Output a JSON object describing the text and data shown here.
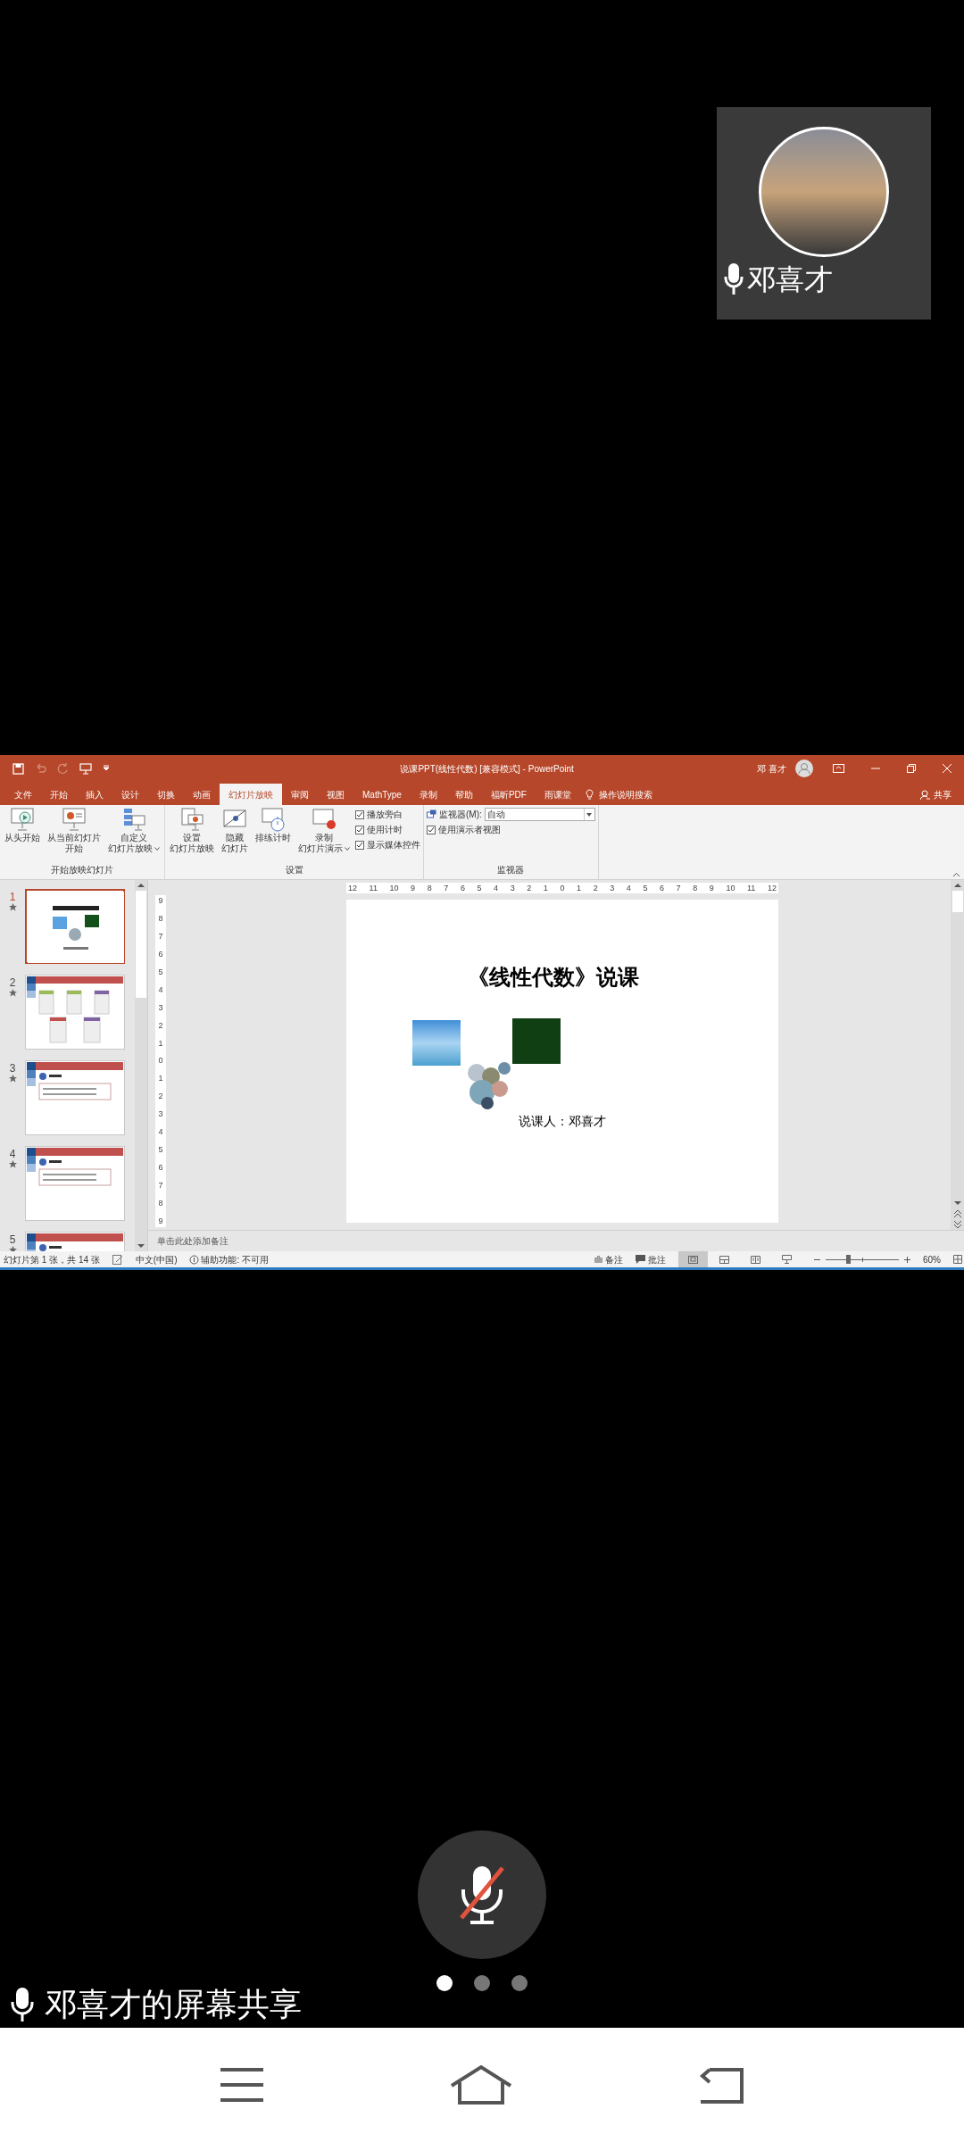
{
  "video_tile": {
    "name": "邓喜才"
  },
  "powerpoint": {
    "title": "说课PPT(线性代数) [兼容模式] - PowerPoint",
    "user": "邓 喜才",
    "tabs": [
      {
        "label": "文件",
        "selected": false
      },
      {
        "label": "开始",
        "selected": false
      },
      {
        "label": "插入",
        "selected": false
      },
      {
        "label": "设计",
        "selected": false
      },
      {
        "label": "切换",
        "selected": false
      },
      {
        "label": "动画",
        "selected": false
      },
      {
        "label": "幻灯片放映",
        "selected": true
      },
      {
        "label": "审阅",
        "selected": false
      },
      {
        "label": "视图",
        "selected": false
      },
      {
        "label": "MathType",
        "selected": false
      },
      {
        "label": "录制",
        "selected": false
      },
      {
        "label": "帮助",
        "selected": false
      },
      {
        "label": "福昕PDF",
        "selected": false
      },
      {
        "label": "雨课堂",
        "selected": false
      }
    ],
    "tell_me": "操作说明搜索",
    "share": "共享",
    "ribbon_groups": [
      {
        "label": "开始放映幻灯片",
        "items": [
          {
            "kind": "large",
            "lines": [
              "从头开始"
            ]
          },
          {
            "kind": "large",
            "lines": [
              "从当前幻灯片",
              "开始"
            ]
          },
          {
            "kind": "dropdown",
            "lines": [
              "自定义",
              "幻灯片放映"
            ]
          }
        ]
      },
      {
        "label": "设置",
        "items": [
          {
            "kind": "large",
            "lines": [
              "设置",
              "幻灯片放映"
            ]
          },
          {
            "kind": "large",
            "lines": [
              "隐藏",
              "幻灯片"
            ]
          },
          {
            "kind": "large",
            "lines": [
              "排练计时"
            ]
          },
          {
            "kind": "dropdown",
            "lines": [
              "录制",
              "幻灯片演示"
            ]
          },
          {
            "kind": "checks",
            "checks": [
              {
                "label": "播放旁白",
                "checked": true
              },
              {
                "label": "使用计时",
                "checked": true
              },
              {
                "label": "显示媒体控件",
                "checked": true
              }
            ]
          }
        ]
      },
      {
        "label": "监视器",
        "items": [
          {
            "kind": "monitor",
            "label": "监视器(M):",
            "value": "自动",
            "checks": [
              {
                "label": "使用演示者视图",
                "checked": true
              }
            ]
          }
        ]
      }
    ],
    "slides": [
      {
        "number": "1",
        "kind": "title",
        "selected": true
      },
      {
        "number": "2",
        "kind": "cards",
        "selected": false
      },
      {
        "number": "3",
        "kind": "content",
        "selected": false
      },
      {
        "number": "4",
        "kind": "content",
        "selected": false
      },
      {
        "number": "5",
        "kind": "content",
        "selected": false
      }
    ],
    "ruler_h": [
      "12",
      "11",
      "10",
      "9",
      "8",
      "7",
      "6",
      "5",
      "4",
      "3",
      "2",
      "1",
      "0",
      "1",
      "2",
      "3",
      "4",
      "5",
      "6",
      "7",
      "8",
      "9",
      "10",
      "11",
      "12"
    ],
    "ruler_v": [
      "9",
      "8",
      "7",
      "6",
      "5",
      "4",
      "3",
      "2",
      "1",
      "0",
      "1",
      "2",
      "3",
      "4",
      "5",
      "6",
      "7",
      "8",
      "9"
    ],
    "slide": {
      "title": "《线性代数》说课",
      "author": "说课人：邓喜才"
    },
    "notes_placeholder": "单击此处添加备注",
    "status": {
      "slide_info": "幻灯片第 1 张，共 14 张",
      "language": "中文(中国)",
      "accessibility": "辅助功能: 不可用",
      "notes": "备注",
      "comments": "批注",
      "zoom_slider": {
        "level": 0.3
      },
      "zoom": "60%"
    }
  },
  "mic_muted": true,
  "pager": [
    {
      "selected": true
    },
    {
      "selected": false
    },
    {
      "selected": false
    }
  ],
  "caption": "邓喜才的屏幕共享"
}
